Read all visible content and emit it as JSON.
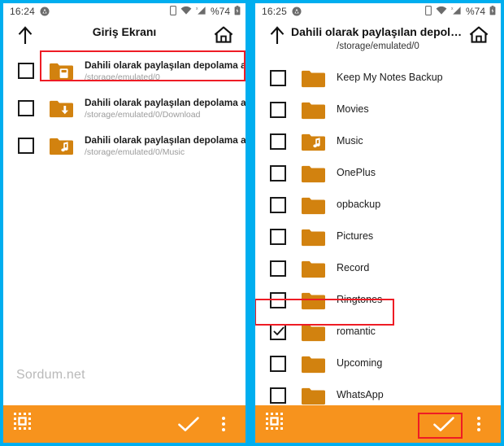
{
  "annotation": {
    "watermark": "Sordum.net",
    "highlight_color": "#ee1c25"
  },
  "theme": {
    "frame_border": "#00aeef",
    "accent_orange": "#f7931d",
    "folder_orange": "#d2820f",
    "folder_orange_light": "#e08a17"
  },
  "left_panel": {
    "statusbar": {
      "time": "16:24",
      "battery_percent": "%74",
      "icons": [
        "notification-circle-icon",
        "sim-icon",
        "wifi-icon",
        "signal-icon",
        "battery-icon"
      ]
    },
    "header": {
      "back_icon": "up-arrow-icon",
      "title": "Giriş Ekranı",
      "subtitle": "",
      "home_icon": "home-icon"
    },
    "items": [
      {
        "title": "Dahili olarak paylaşılan depolama alanı",
        "path": "/storage/emulated/0",
        "icon": "folder-storage-icon",
        "checked": false,
        "highlighted": true
      },
      {
        "title": "Dahili olarak paylaşılan depolama alanı..",
        "path": "/storage/emulated/0/Download",
        "icon": "folder-download-icon",
        "checked": false,
        "highlighted": false
      },
      {
        "title": "Dahili olarak paylaşılan depolama alanı..",
        "path": "/storage/emulated/0/Music",
        "icon": "folder-music-icon",
        "checked": false,
        "highlighted": false
      }
    ],
    "bottombar": {
      "select_all_icon": "select-all-icon",
      "confirm_icon": "check-icon",
      "overflow_icon": "more-vertical-icon",
      "confirm_highlighted": false
    }
  },
  "right_panel": {
    "statusbar": {
      "time": "16:25",
      "battery_percent": "%74",
      "icons": [
        "notification-circle-icon",
        "sim-icon",
        "wifi-icon",
        "signal-icon",
        "battery-icon"
      ]
    },
    "header": {
      "back_icon": "up-arrow-icon",
      "title": "Dahili olarak paylaşılan depola...",
      "subtitle": "/storage/emulated/0",
      "home_icon": "home-icon"
    },
    "items": [
      {
        "title": "Keep My Notes Backup",
        "icon": "folder-icon",
        "checked": false,
        "highlighted": false
      },
      {
        "title": "Movies",
        "icon": "folder-icon",
        "checked": false,
        "highlighted": false
      },
      {
        "title": "Music",
        "icon": "folder-music-icon",
        "checked": false,
        "highlighted": false
      },
      {
        "title": "OnePlus",
        "icon": "folder-icon",
        "checked": false,
        "highlighted": false
      },
      {
        "title": "opbackup",
        "icon": "folder-icon",
        "checked": false,
        "highlighted": false
      },
      {
        "title": "Pictures",
        "icon": "folder-icon",
        "checked": false,
        "highlighted": false
      },
      {
        "title": "Record",
        "icon": "folder-icon",
        "checked": false,
        "highlighted": false
      },
      {
        "title": "Ringtones",
        "icon": "folder-icon",
        "checked": false,
        "highlighted": false
      },
      {
        "title": "romantic",
        "icon": "folder-icon",
        "checked": true,
        "highlighted": true
      },
      {
        "title": "Upcoming",
        "icon": "folder-icon",
        "checked": false,
        "highlighted": false
      },
      {
        "title": "WhatsApp",
        "icon": "folder-icon",
        "checked": false,
        "highlighted": false
      }
    ],
    "bottombar": {
      "select_all_icon": "select-all-icon",
      "confirm_icon": "check-icon",
      "overflow_icon": "more-vertical-icon",
      "confirm_highlighted": true
    }
  }
}
